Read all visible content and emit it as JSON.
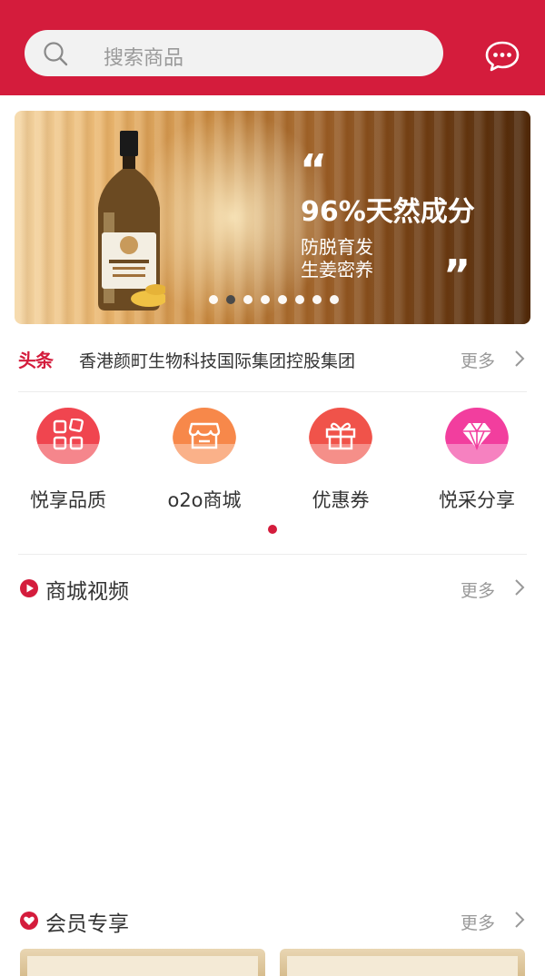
{
  "search": {
    "placeholder": "搜索商品"
  },
  "banner": {
    "quote_open": "“",
    "headline": "96%天然成分",
    "sub_line1": "防脱育发",
    "sub_line2": "生姜密养",
    "quote_close": "”",
    "slide_count": 8,
    "active_slide": 2
  },
  "news": {
    "tag": "头条",
    "text": "香港颜町生物科技国际集团控股集团",
    "more": "更多"
  },
  "categories": [
    {
      "label": "悦享品质",
      "icon": "grid-icon",
      "color": "#f0454f"
    },
    {
      "label": "o2o商城",
      "icon": "store-icon",
      "color": "#f7884a"
    },
    {
      "label": "优惠券",
      "icon": "gift-icon",
      "color": "#f0534a"
    },
    {
      "label": "悦采分享",
      "icon": "diamond-icon",
      "color": "#f23e9e"
    }
  ],
  "video_section": {
    "title": "商城视频",
    "more": "更多"
  },
  "member_section": {
    "title": "会员专享",
    "more": "更多"
  },
  "colors": {
    "brand": "#d41c3c"
  }
}
